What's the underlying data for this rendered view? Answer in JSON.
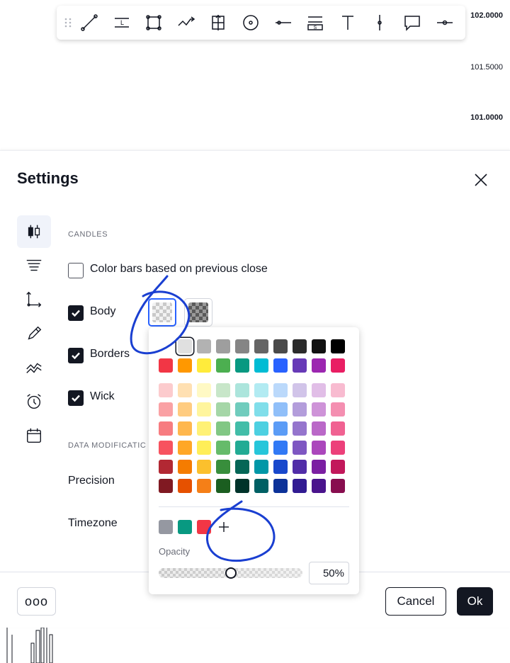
{
  "toolbar": {
    "tools": [
      {
        "icon": "trend-line-icon"
      },
      {
        "icon": "horizontal-ray-label-icon",
        "glyph": "L"
      },
      {
        "icon": "rectangle-icon"
      },
      {
        "icon": "path-icon"
      },
      {
        "icon": "long-short-position-icon"
      },
      {
        "icon": "circle-target-icon"
      },
      {
        "icon": "horizontal-line-icon"
      },
      {
        "icon": "parallel-channel-icon",
        "glyph": "S"
      },
      {
        "icon": "text-icon"
      },
      {
        "icon": "vertical-line-icon"
      },
      {
        "icon": "callout-icon"
      },
      {
        "icon": "horizontal-segment-icon"
      }
    ]
  },
  "price_axis": {
    "labels": [
      {
        "text": "102.0000",
        "bold": true
      },
      {
        "text": "101.5000",
        "bold": false
      },
      {
        "text": "101.0000",
        "bold": true
      }
    ]
  },
  "dialog": {
    "title": "Settings",
    "tabs": [
      {
        "icon": "candles-icon",
        "active": true
      },
      {
        "icon": "status-line-icon",
        "active": false
      },
      {
        "icon": "scales-icon",
        "active": false
      },
      {
        "icon": "appearance-pencil-icon",
        "active": false
      },
      {
        "icon": "trading-icon",
        "active": false
      },
      {
        "icon": "alerts-clock-icon",
        "active": false
      },
      {
        "icon": "events-calendar-icon",
        "active": false
      }
    ],
    "candles": {
      "section_title": "CANDLES",
      "color_bars_label": "Color bars based on previous close",
      "color_bars_checked": false,
      "body_label": "Body",
      "body_checked": true,
      "borders_label": "Borders",
      "borders_checked": true,
      "wick_label": "Wick",
      "wick_checked": true
    },
    "data_modification": {
      "section_title": "DATA MODIFICATIC",
      "precision_label": "Precision",
      "timezone_label": "Timezone"
    },
    "footer": {
      "more_label": "ooo",
      "cancel_label": "Cancel",
      "ok_label": "Ok"
    }
  },
  "color_picker": {
    "rows": [
      [
        "#ffffff",
        "#e0e0e0",
        "#b2b2b2",
        "#9e9e9e",
        "#858585",
        "#656565",
        "#4a4a4a",
        "#2b2b2b",
        "#111111",
        "#000000"
      ],
      [
        "#f23645",
        "#ff9800",
        "#ffeb3b",
        "#4caf50",
        "#089981",
        "#00bcd4",
        "#2962ff",
        "#673ab7",
        "#9c27b0",
        "#e91e63"
      ],
      [
        "#fccbcd",
        "#ffe0b2",
        "#fff9c4",
        "#c8e6c9",
        "#ace5dc",
        "#b2ebf2",
        "#bbd9fb",
        "#d1c4e9",
        "#e1bee7",
        "#f8bbd0"
      ],
      [
        "#faa1a4",
        "#ffcc80",
        "#fff59d",
        "#a5d6a7",
        "#70ccbd",
        "#80deea",
        "#90bff9",
        "#b39ddb",
        "#ce93d8",
        "#f48fb1"
      ],
      [
        "#f77c80",
        "#ffb74d",
        "#fff176",
        "#81c784",
        "#42bda8",
        "#4dd0e1",
        "#5b9cf6",
        "#9575cd",
        "#ba68c8",
        "#f06292"
      ],
      [
        "#f7525f",
        "#ffa726",
        "#ffee58",
        "#66bb6a",
        "#22ab94",
        "#26c6da",
        "#3179f5",
        "#7e57c2",
        "#ab47bc",
        "#ec407a"
      ],
      [
        "#b22833",
        "#f57c00",
        "#fbc02d",
        "#388e3c",
        "#056656",
        "#0097a7",
        "#1848cc",
        "#512da8",
        "#7b1fa2",
        "#c2185b"
      ],
      [
        "#801922",
        "#e65100",
        "#f57f17",
        "#1b5e20",
        "#00332a",
        "#006064",
        "#0c3299",
        "#311b92",
        "#4a148c",
        "#880e4f"
      ]
    ],
    "selected": {
      "row": 0,
      "col": 1
    },
    "custom_colors": [
      "#9598a1",
      "#089981",
      "#f23645"
    ],
    "opacity_label": "Opacity",
    "opacity_value": 0.5,
    "opacity_text": "50%"
  },
  "colors": {
    "accent": "#2962ff",
    "text": "#131722",
    "annotation": "#1a3fd1"
  }
}
